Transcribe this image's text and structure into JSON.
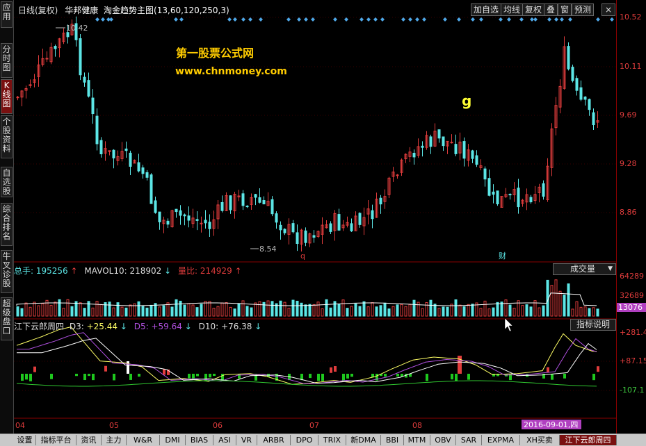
{
  "sidebar": [
    {
      "label": "应用",
      "active": false
    },
    {
      "label": "分时图",
      "active": false
    },
    {
      "label": "K线图",
      "active": true
    },
    {
      "label": "个股资料",
      "active": false
    },
    {
      "label": "自选股",
      "active": false
    },
    {
      "label": "综合排名",
      "active": false
    },
    {
      "label": "牛叉诊股",
      "active": false
    },
    {
      "label": "超级盘口",
      "active": false
    }
  ],
  "header": {
    "period": "日线(复权)",
    "stock": "华邦健康",
    "indicator": "淘金趋势主图(13,60,120,250,3)"
  },
  "toolbar": [
    "加自选",
    "均线",
    "复权",
    "叠",
    "窗",
    "预测"
  ],
  "close_icon": "×",
  "watermark": {
    "site_name": "第一股票公式网",
    "site_url": "www.chnmoney.com"
  },
  "price_annotations": {
    "high": "10.42",
    "low": "8.54",
    "g_label": "g",
    "q_label": "q",
    "cai_label": "财"
  },
  "volume_panel": {
    "total_label": "总手:",
    "total_value": "195256",
    "total_arrow": "↑",
    "mavol_label": "MAVOL10:",
    "mavol_value": "218902",
    "mavol_arrow": "↓",
    "ratio_label": "量比:",
    "ratio_value": "214929",
    "ratio_arrow": "↑",
    "dropdown": "成交量"
  },
  "indicator_panel": {
    "name": "江下云郎周四",
    "d3_label": "D3:",
    "d3_value": "+25.44",
    "d3_arrow": "↓",
    "d5_label": "D5:",
    "d5_value": "+59.64",
    "d5_arrow": "↓",
    "d10_label": "D10:",
    "d10_value": "+76.38",
    "d10_arrow": "↓",
    "explain_button": "指标说明"
  },
  "y_axis": {
    "price": [
      "10.52",
      "10.11",
      "9.69",
      "9.28",
      "8.86"
    ],
    "volume": [
      "64289",
      "32689",
      "13076"
    ],
    "indicator": [
      "+281.4",
      "+87.15",
      "-107.1"
    ]
  },
  "x_axis": {
    "months": [
      "04",
      "05",
      "06",
      "07",
      "08"
    ],
    "date_badge": "2016-09-01,四"
  },
  "bottom_tabs": [
    {
      "label": "设置",
      "active": false
    },
    {
      "label": "指标平台",
      "active": false
    },
    {
      "label": "资讯",
      "active": false
    },
    {
      "label": "主力",
      "active": false
    },
    {
      "label": "W&R",
      "active": false
    },
    {
      "label": "DMI",
      "active": false
    },
    {
      "label": "BIAS",
      "active": false
    },
    {
      "label": "ASI",
      "active": false
    },
    {
      "label": "VR",
      "active": false
    },
    {
      "label": "ARBR",
      "active": false
    },
    {
      "label": "DPO",
      "active": false
    },
    {
      "label": "TRIX",
      "active": false
    },
    {
      "label": "新DMA",
      "active": false
    },
    {
      "label": "BBI",
      "active": false
    },
    {
      "label": "MTM",
      "active": false
    },
    {
      "label": "OBV",
      "active": false
    },
    {
      "label": "SAR",
      "active": false
    },
    {
      "label": "EXPMA",
      "active": false
    },
    {
      "label": "XH买卖",
      "active": false
    },
    {
      "label": "江下云郎周四",
      "active": true
    }
  ],
  "colors": {
    "up": "#e03c3c",
    "down": "#5ce6e6",
    "accent": "#7a1010",
    "ma_white": "#ffffff",
    "ma_yellow": "#ffff66",
    "ma_purple": "#b050e0",
    "badge": "#b040c0"
  }
}
